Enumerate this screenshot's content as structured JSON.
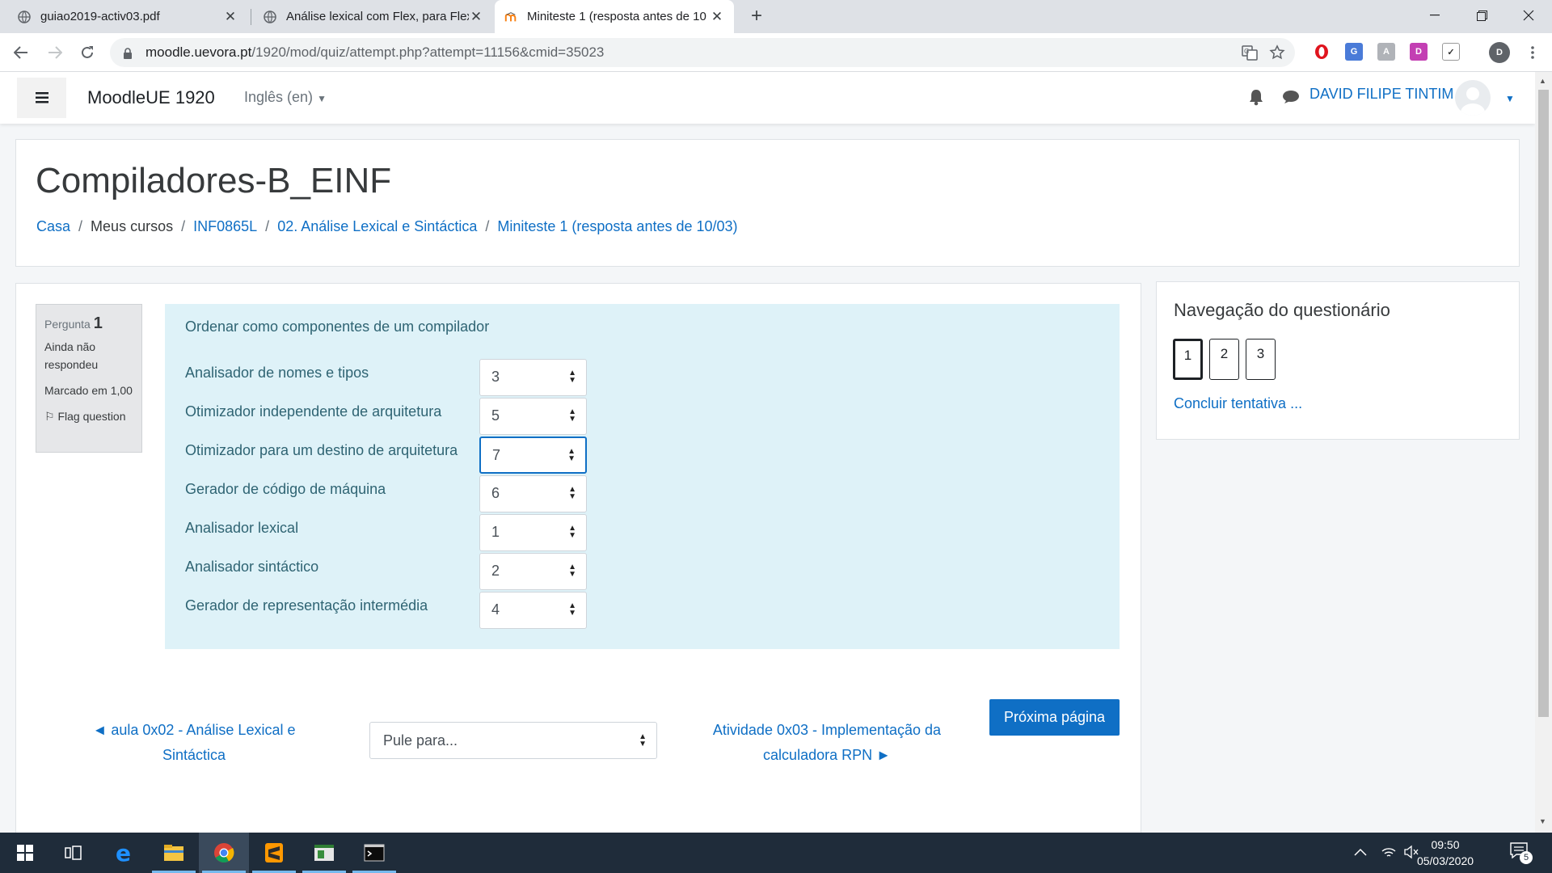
{
  "browser": {
    "tabs": [
      {
        "title": "guiao2019-activ03.pdf"
      },
      {
        "title": "Análise lexical com Flex, para Flex"
      },
      {
        "title": "Miniteste 1 (resposta antes de 10"
      }
    ],
    "url_host": "moodle.uevora.pt",
    "url_path": "/1920/mod/quiz/attempt.php?attempt=11156&cmid=35023",
    "profile_initial": "D"
  },
  "moodle": {
    "brand": "MoodleUE 1920",
    "language": "Inglês (en)",
    "user": "DAVID FILIPE TINTIM"
  },
  "header": {
    "course_title": "Compiladores-B_EINF",
    "breadcrumb": [
      "Casa",
      "Meus cursos",
      "INF0865L",
      "02. Análise Lexical e Sintáctica",
      "Miniteste 1 (resposta antes de 10/03)"
    ]
  },
  "question_info": {
    "label": "Pergunta",
    "number": "1",
    "status": "Ainda não respondeu",
    "marks": "Marcado em 1,00",
    "flag": "Flag question"
  },
  "question": {
    "text": "Ordenar como componentes de um compilador",
    "items": [
      {
        "label": "Analisador de nomes e tipos",
        "value": "3"
      },
      {
        "label": "Otimizador independente de arquitetura",
        "value": "5"
      },
      {
        "label": "Otimizador para um destino de arquitetura",
        "value": "7"
      },
      {
        "label": "Gerador de código de máquina",
        "value": "6"
      },
      {
        "label": "Analisador lexical",
        "value": "1"
      },
      {
        "label": "Analisador sintáctico",
        "value": "2"
      },
      {
        "label": "Gerador de representação intermédia",
        "value": "4"
      }
    ]
  },
  "navigation": {
    "prev_link": "◄ aula 0x02 - Análise Lexical e Sintáctica",
    "jump_placeholder": "Pule para...",
    "next_link": "Atividade 0x03 - Implementação da calculadora RPN ►",
    "next_button": "Próxima página"
  },
  "quiz_nav": {
    "title": "Navegação do questionário",
    "buttons": [
      "1",
      "2",
      "3"
    ],
    "finish": "Concluir tentativa ..."
  },
  "taskbar": {
    "time": "09:50",
    "date": "05/03/2020",
    "notifications": "5"
  }
}
